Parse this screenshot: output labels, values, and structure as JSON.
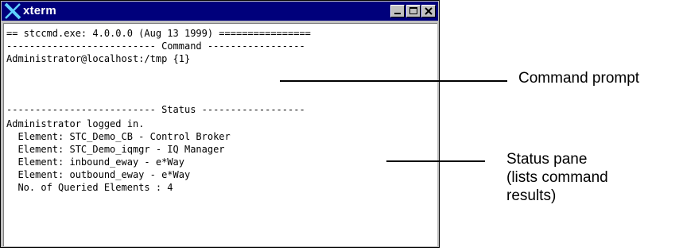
{
  "window": {
    "title": "xterm"
  },
  "terminal": {
    "lines": [
      "== stccmd.exe: 4.0.0.0 (Aug 13 1999) ================",
      "-------------------------- Command -----------------",
      "Administrator@localhost:/tmp {1}",
      "",
      "",
      "-------------------------- Status ------------------",
      "Administrator logged in.",
      "  Element: STC_Demo_CB - Control Broker",
      "  Element: STC_Demo_iqmgr - IQ Manager",
      "  Element: inbound_eway - e*Way",
      "  Element: outbound_eway - e*Way",
      "  No. of Queried Elements : 4"
    ]
  },
  "callouts": {
    "command_prompt": "Command prompt",
    "status_pane": "Status pane\n(lists command\nresults)"
  }
}
